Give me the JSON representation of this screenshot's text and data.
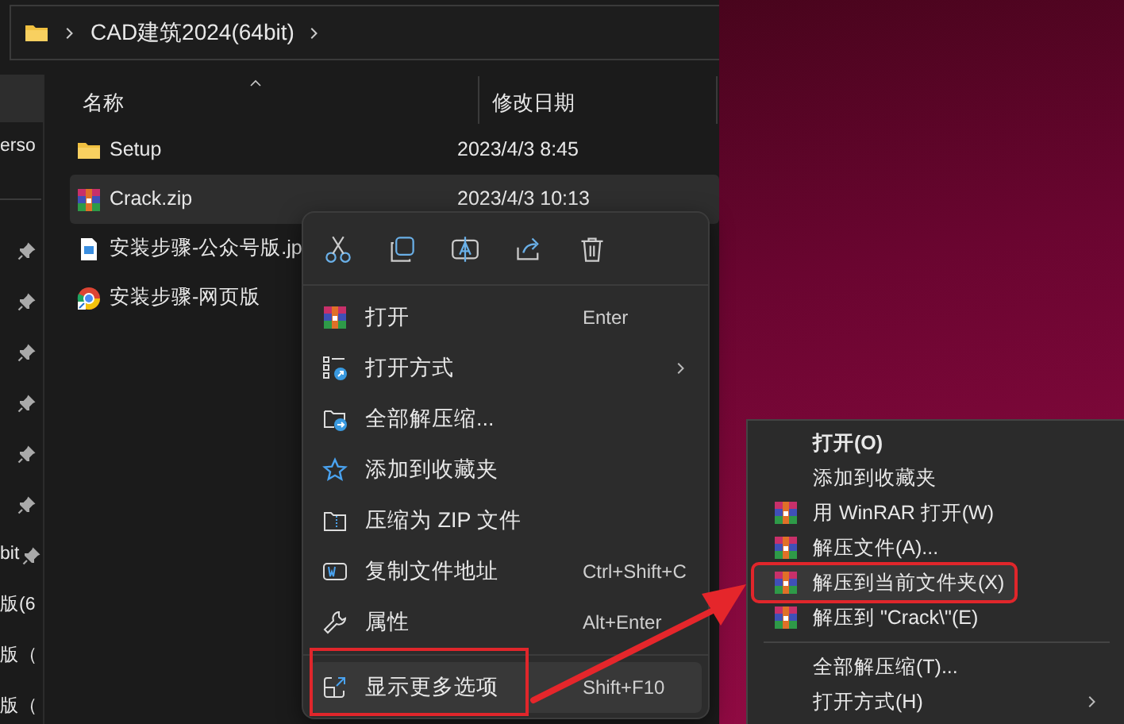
{
  "address_bar": {
    "path": "CAD建筑2024(64bit)"
  },
  "sidebar": {
    "groups": [
      [
        {
          "selected": true,
          "pinned": false
        },
        {
          "label": "erso",
          "selected": false,
          "pinned": false
        }
      ],
      [
        {
          "selected": false,
          "pinned": true
        },
        {
          "selected": false,
          "pinned": true
        },
        {
          "selected": false,
          "pinned": true
        },
        {
          "selected": false,
          "pinned": true
        },
        {
          "selected": false,
          "pinned": true
        },
        {
          "selected": false,
          "pinned": true
        },
        {
          "label": "bit",
          "selected": false,
          "pinned": true
        },
        {
          "label": "版(6",
          "selected": false,
          "pinned": false
        },
        {
          "label": "版（",
          "selected": false,
          "pinned": false
        },
        {
          "label": "版（",
          "selected": false,
          "pinned": false
        }
      ]
    ]
  },
  "columns": [
    {
      "label": "名称",
      "sorted": true
    },
    {
      "label": "修改日期",
      "sorted": false
    }
  ],
  "files": [
    {
      "name": "Setup",
      "modified": "2023/4/3 8:45",
      "kind": "folder",
      "selected": false
    },
    {
      "name": "Crack.zip",
      "modified": "2023/4/3 10:13",
      "kind": "archive",
      "selected": true
    },
    {
      "name": "安装步骤-公众号版.jp",
      "kind": "image",
      "selected": false
    },
    {
      "name": "安装步骤-网页版",
      "kind": "shortcut",
      "selected": false
    }
  ],
  "context_menu": {
    "groups": [
      [
        {
          "label": "打开",
          "shortcut": "Enter",
          "kind": "archive",
          "submenu": false,
          "selected": false,
          "highlighted": false
        },
        {
          "label": "打开方式",
          "kind": "open-with",
          "submenu": true,
          "selected": false,
          "highlighted": false
        },
        {
          "label": "全部解压缩...",
          "kind": "extract",
          "submenu": false,
          "selected": false,
          "highlighted": false
        },
        {
          "label": "添加到收藏夹",
          "kind": "star",
          "submenu": false,
          "selected": false,
          "highlighted": false
        },
        {
          "label": "压缩为 ZIP 文件",
          "kind": "zip",
          "submenu": false,
          "selected": false,
          "highlighted": false
        },
        {
          "label": "复制文件地址",
          "shortcut": "Ctrl+Shift+C",
          "kind": "path",
          "submenu": false,
          "selected": false,
          "highlighted": false
        },
        {
          "label": "属性",
          "shortcut": "Alt+Enter",
          "kind": "wrench",
          "submenu": false,
          "selected": false,
          "highlighted": false
        }
      ],
      [
        {
          "label": "显示更多选项",
          "shortcut": "Shift+F10",
          "kind": "more",
          "submenu": false,
          "selected": true,
          "highlighted": true
        }
      ]
    ]
  },
  "classic_menu": {
    "groups": [
      [
        {
          "label": "打开(O)",
          "kind": "plain",
          "bold": true,
          "submenu": false,
          "selected": false,
          "highlighted": false
        },
        {
          "label": "添加到收藏夹",
          "kind": "plain",
          "bold": false,
          "submenu": false,
          "selected": false,
          "highlighted": false
        },
        {
          "label": "用 WinRAR 打开(W)",
          "kind": "archive",
          "bold": false,
          "submenu": false,
          "selected": false,
          "highlighted": false
        },
        {
          "label": "解压文件(A)...",
          "kind": "archive",
          "bold": false,
          "submenu": false,
          "selected": false,
          "highlighted": false
        },
        {
          "label": "解压到当前文件夹(X)",
          "kind": "archive",
          "bold": false,
          "submenu": false,
          "selected": true,
          "highlighted": true
        },
        {
          "label": "解压到 \"Crack\\\"(E)",
          "kind": "archive",
          "bold": false,
          "submenu": false,
          "selected": false,
          "highlighted": false
        }
      ],
      [
        {
          "label": "全部解压缩(T)...",
          "kind": "plain",
          "bold": false,
          "submenu": false,
          "selected": false,
          "highlighted": false
        },
        {
          "label": "打开方式(H)",
          "kind": "plain",
          "bold": false,
          "submenu": true,
          "selected": false,
          "highlighted": false
        }
      ]
    ]
  }
}
